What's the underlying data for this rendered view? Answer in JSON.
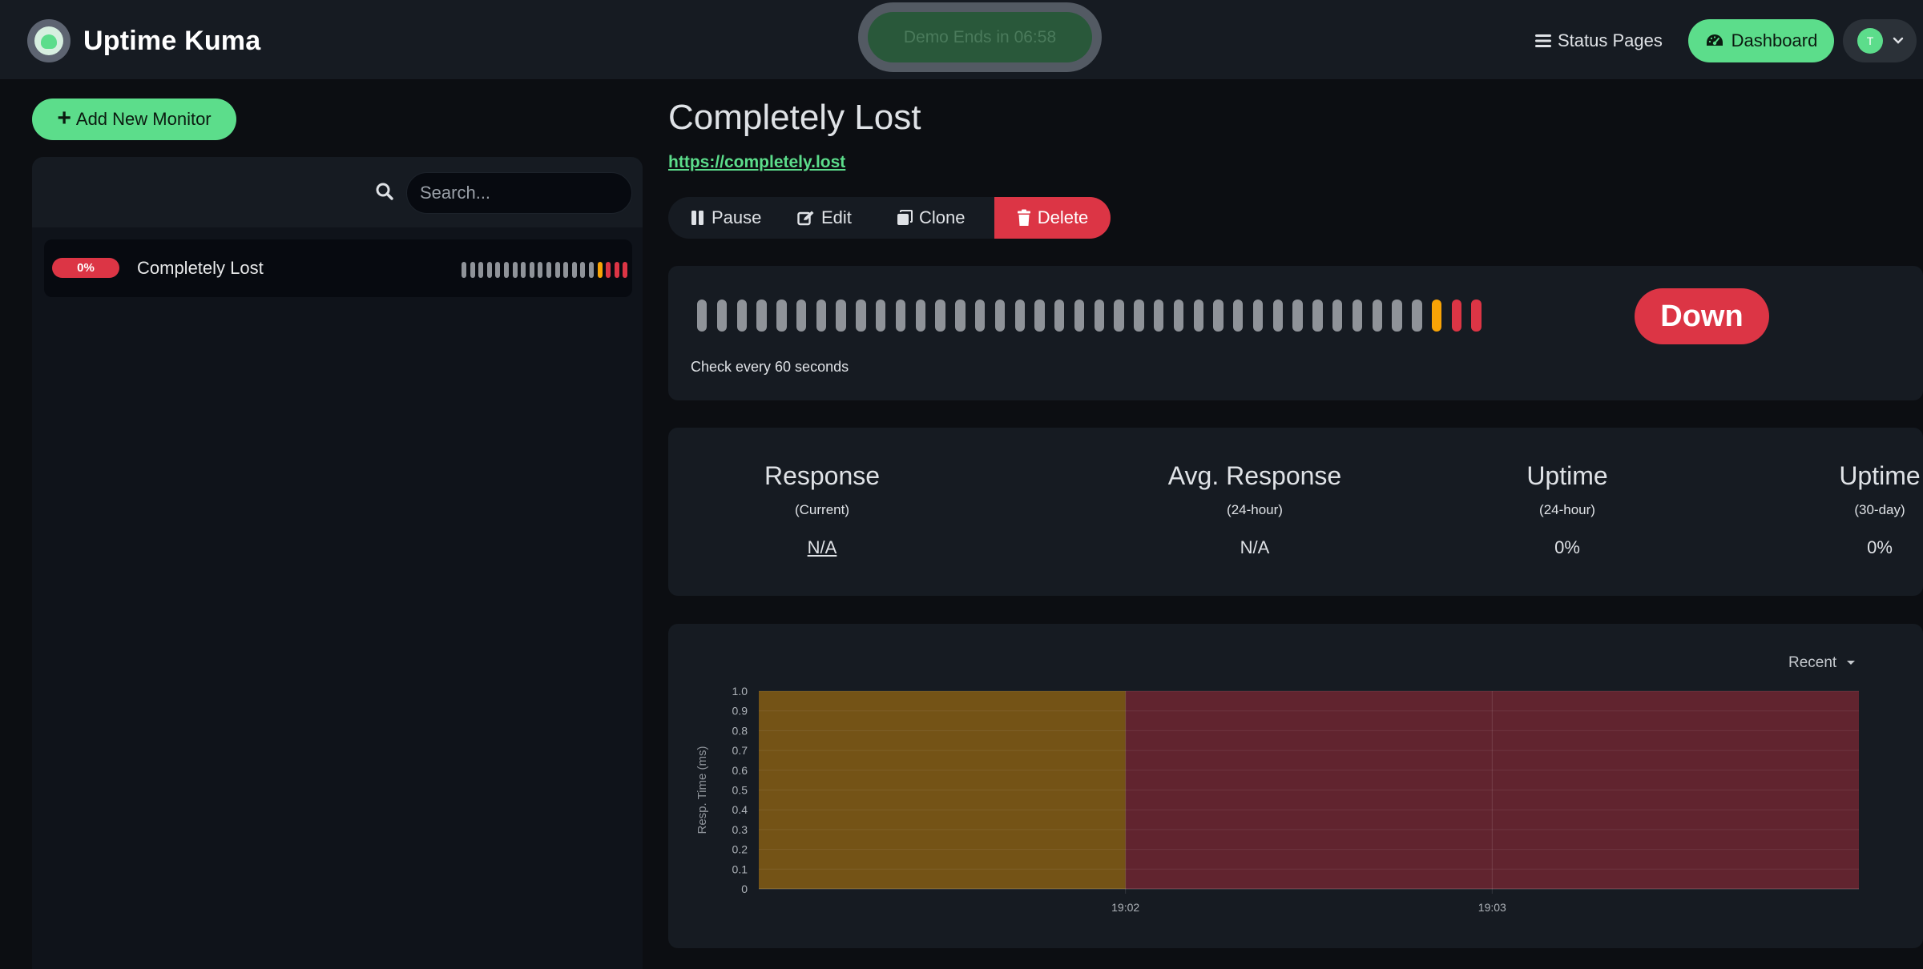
{
  "app": {
    "title": "Uptime Kuma"
  },
  "header": {
    "demo_banner": "Demo Ends in 06:58",
    "status_pages_label": "Status Pages",
    "dashboard_label": "Dashboard",
    "avatar_initial": "T"
  },
  "sidebar": {
    "add_monitor_label": "Add New Monitor",
    "search": {
      "placeholder": "Search...",
      "value": ""
    },
    "monitors": [
      {
        "uptime_badge": "0%",
        "name": "Completely Lost",
        "beats": [
          "empty",
          "empty",
          "empty",
          "empty",
          "empty",
          "empty",
          "empty",
          "empty",
          "empty",
          "empty",
          "empty",
          "empty",
          "empty",
          "empty",
          "empty",
          "empty",
          "pending",
          "down",
          "down",
          "down"
        ]
      }
    ]
  },
  "monitor": {
    "name": "Completely Lost",
    "url": "https://completely.lost",
    "actions": {
      "pause": "Pause",
      "edit": "Edit",
      "clone": "Clone",
      "delete": "Delete"
    },
    "heartbeats": [
      "empty",
      "empty",
      "empty",
      "empty",
      "empty",
      "empty",
      "empty",
      "empty",
      "empty",
      "empty",
      "empty",
      "empty",
      "empty",
      "empty",
      "empty",
      "empty",
      "empty",
      "empty",
      "empty",
      "empty",
      "empty",
      "empty",
      "empty",
      "empty",
      "empty",
      "empty",
      "empty",
      "empty",
      "empty",
      "empty",
      "empty",
      "empty",
      "empty",
      "empty",
      "empty",
      "empty",
      "empty",
      "pending",
      "down",
      "down"
    ],
    "check_interval_text": "Check every 60 seconds",
    "status": "Down",
    "stats": [
      {
        "title": "Response",
        "sub": "(Current)",
        "value": "N/A"
      },
      {
        "title": "Avg. Response",
        "sub": "(24-hour)",
        "value": "N/A"
      },
      {
        "title": "Uptime",
        "sub": "(24-hour)",
        "value": "0%"
      },
      {
        "title": "Uptime",
        "sub": "(30-day)",
        "value": "0%"
      }
    ],
    "chart_period": "Recent"
  },
  "colors": {
    "brand_green": "#5cdd8b",
    "down_red": "#dc3545",
    "pending_amber": "#f8a306",
    "empty_beat": "#8f9399"
  },
  "chart_data": {
    "type": "area",
    "title": "",
    "xlabel": "",
    "ylabel": "Resp. Time (ms)",
    "ylim": [
      0,
      1
    ],
    "y_ticks": [
      "0",
      "0.1",
      "0.2",
      "0.3",
      "0.4",
      "0.5",
      "0.6",
      "0.7",
      "0.8",
      "0.9",
      "1.0"
    ],
    "x_ticks": [
      "19:02",
      "19:03"
    ],
    "bands": [
      {
        "status": "pending",
        "from": "19:01",
        "to": "19:02",
        "color": "#f8a306"
      },
      {
        "status": "down",
        "from": "19:02",
        "to": "19:04",
        "color": "#dc3545"
      }
    ]
  }
}
